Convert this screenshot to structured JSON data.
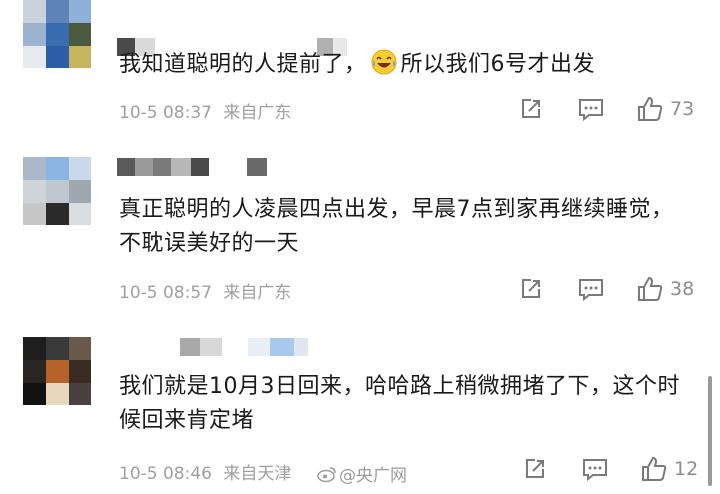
{
  "comments": [
    {
      "text": "我知道聪明的人提前了，",
      "text_after_emoji": "所以我们6号才出发",
      "emoji": "laughing-crying-emoji",
      "date": "10-5 08:37",
      "location": "来自广东",
      "likes": "73"
    },
    {
      "text": "真正聪明的人凌晨四点出发，早晨7点到家再继续睡觉，不耽误美好的一天",
      "date": "10-5 08:57",
      "location": "来自广东",
      "likes": "38"
    },
    {
      "text": "我们就是10月3日回来，哈哈路上稍微拥堵了下，这个时候回来肯定堵",
      "date": "10-5 08:46",
      "location": "来自天津",
      "likes": "12"
    }
  ],
  "watermark": "@央广网",
  "icons": {
    "share": "share-icon",
    "comment": "comment-icon",
    "like": "thumbs-up-icon"
  },
  "colors": {
    "text": "#1a1a1a",
    "meta": "#a0a0a0",
    "icon": "#7a7a7a"
  }
}
